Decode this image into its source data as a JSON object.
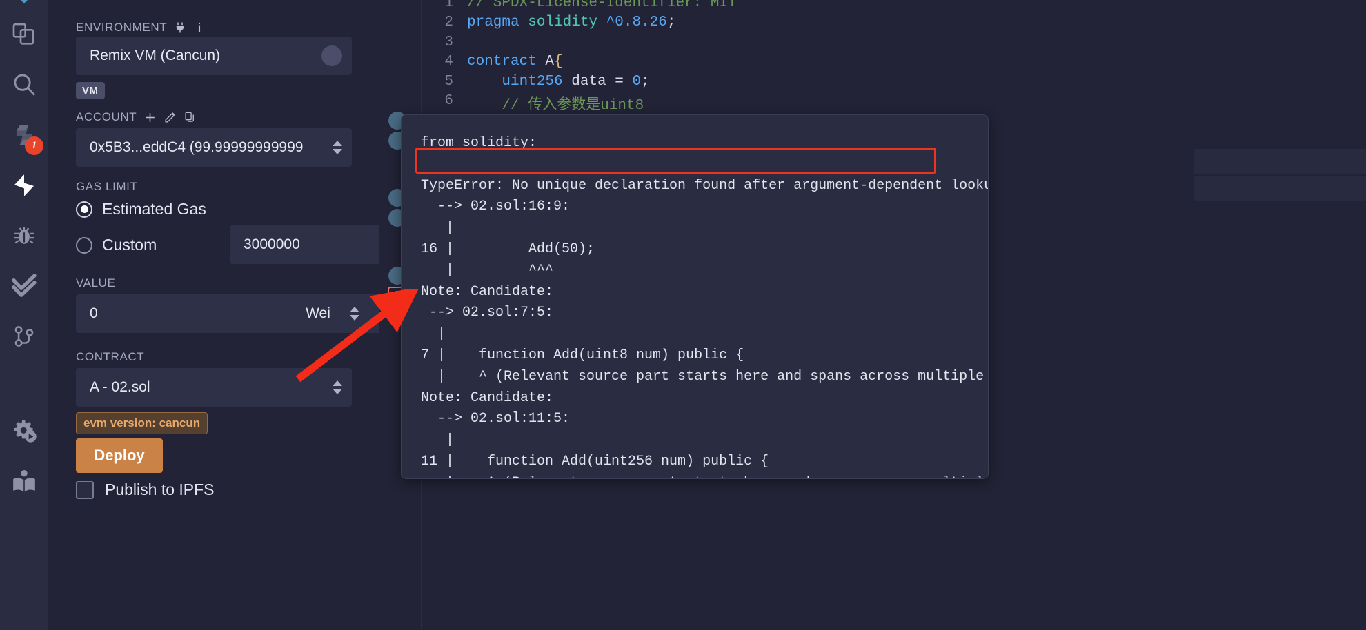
{
  "rail": {
    "items": [
      {
        "name": "file-explorer-icon",
        "label": "File explorer"
      },
      {
        "name": "search-icon",
        "label": "Search in files"
      },
      {
        "name": "solidity-compiler-icon",
        "label": "Solidity compiler",
        "badge": "1"
      },
      {
        "name": "deploy-run-icon",
        "label": "Deploy & run transactions",
        "active": true
      },
      {
        "name": "debugger-icon",
        "label": "Debugger"
      },
      {
        "name": "solidity-unit-testing-icon",
        "label": "Solidity unit testing"
      },
      {
        "name": "git-icon",
        "label": "Git"
      },
      {
        "name": "settings-icon",
        "label": "Settings"
      },
      {
        "name": "learneth-icon",
        "label": "LearnEth"
      }
    ]
  },
  "deploy_panel": {
    "environment": {
      "label": "ENVIRONMENT",
      "value": "Remix VM (Cancun)",
      "plug_icon": "plug-icon",
      "info_icon": "info-icon",
      "chip": "VM"
    },
    "account": {
      "label": "ACCOUNT",
      "value": "0x5B3...eddC4 (99.99999999999",
      "add_icon": "plus-icon",
      "edit_icon": "edit-icon",
      "copy_icon": "copy-icon"
    },
    "gas_limit": {
      "label": "GAS LIMIT",
      "estimated_label": "Estimated Gas",
      "custom_label": "Custom",
      "custom_value": "3000000",
      "selected": "estimated"
    },
    "value": {
      "label": "VALUE",
      "amount": "0",
      "unit": "Wei"
    },
    "contract": {
      "label": "CONTRACT",
      "value": "A - 02.sol",
      "evm_chip": "evm version: cancun"
    },
    "deploy_button": "Deploy",
    "publish_ipfs": "Publish to IPFS"
  },
  "editor": {
    "lines": [
      {
        "no": "1",
        "tokens": [
          {
            "t": "// SPDX-License-Identifier: MIT",
            "c": "t-com"
          }
        ]
      },
      {
        "no": "2",
        "tokens": [
          {
            "t": "pragma",
            "c": "t-key"
          },
          {
            "t": " ",
            "c": "t-pun"
          },
          {
            "t": "solidity",
            "c": "t-typ"
          },
          {
            "t": " ",
            "c": "t-pun"
          },
          {
            "t": "^0.8.26",
            "c": "t-num"
          },
          {
            "t": ";",
            "c": "t-pun"
          }
        ]
      },
      {
        "no": "3",
        "tokens": []
      },
      {
        "no": "4",
        "tokens": [
          {
            "t": "contract",
            "c": "t-key"
          },
          {
            "t": " A",
            "c": "t-id"
          },
          {
            "t": "{",
            "c": "t-br"
          }
        ]
      },
      {
        "no": "5",
        "tokens": [
          {
            "t": "    ",
            "c": "t-pun"
          },
          {
            "t": "uint256",
            "c": "t-key"
          },
          {
            "t": " data ",
            "c": "t-id"
          },
          {
            "t": "= ",
            "c": "t-pun"
          },
          {
            "t": "0",
            "c": "t-num"
          },
          {
            "t": ";",
            "c": "t-pun"
          }
        ]
      },
      {
        "no": "6",
        "tokens": [
          {
            "t": "    // 传入参数是uint8",
            "c": "t-com"
          }
        ]
      }
    ]
  },
  "error_tooltip": {
    "text": "from solidity:\n\nTypeError: No unique declaration found after argument-dependent lookup.\n  --> 02.sol:16:9:\n   |\n16 |         Add(50);\n   |         ^^^\nNote: Candidate:\n --> 02.sol:7:5:\n  |\n7 |    function Add(uint8 num) public {\n  |    ^ (Relevant source part starts here and spans across multiple lines).\nNote: Candidate:\n  --> 02.sol:11:5:\n   |\n11 |    function Add(uint256 num) public {\n   |    ^ (Relevant source part starts here and spans across multiple lines).",
    "highlighted_line": "TypeError: No unique declaration found after argument-dependent lookup.",
    "error_marker": "!",
    "highlight_color": "#f0331f",
    "annotation_arrow_color": "#f22c19"
  }
}
